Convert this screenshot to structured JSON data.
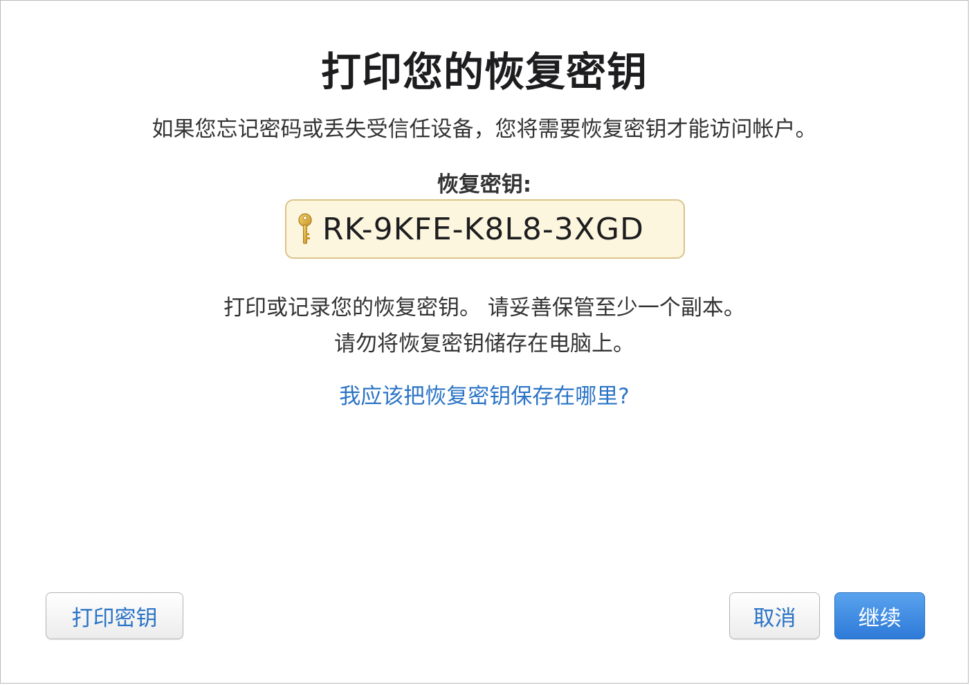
{
  "dialog": {
    "title": "打印您的恢复密钥",
    "subtitle": "如果您忘记密码或丢失受信任设备，您将需要恢复密钥才能访问帐户。",
    "key_label": "恢复密钥:",
    "key_value": "RK-9KFE-K8L8-3XGD",
    "key_icon": "key-icon",
    "instruction_line1": "打印或记录您的恢复密钥。 请妥善保管至少一个副本。",
    "instruction_line2": "请勿将恢复密钥储存在电脑上。",
    "help_link": "我应该把恢复密钥保存在哪里?"
  },
  "buttons": {
    "print": "打印密钥",
    "cancel": "取消",
    "continue": "继续"
  },
  "colors": {
    "accent": "#2b74c6",
    "primary_button": "#2d7ad8",
    "key_box_bg": "#fcf6df",
    "key_box_border": "#d9c389",
    "key_icon": "#d9a933"
  }
}
